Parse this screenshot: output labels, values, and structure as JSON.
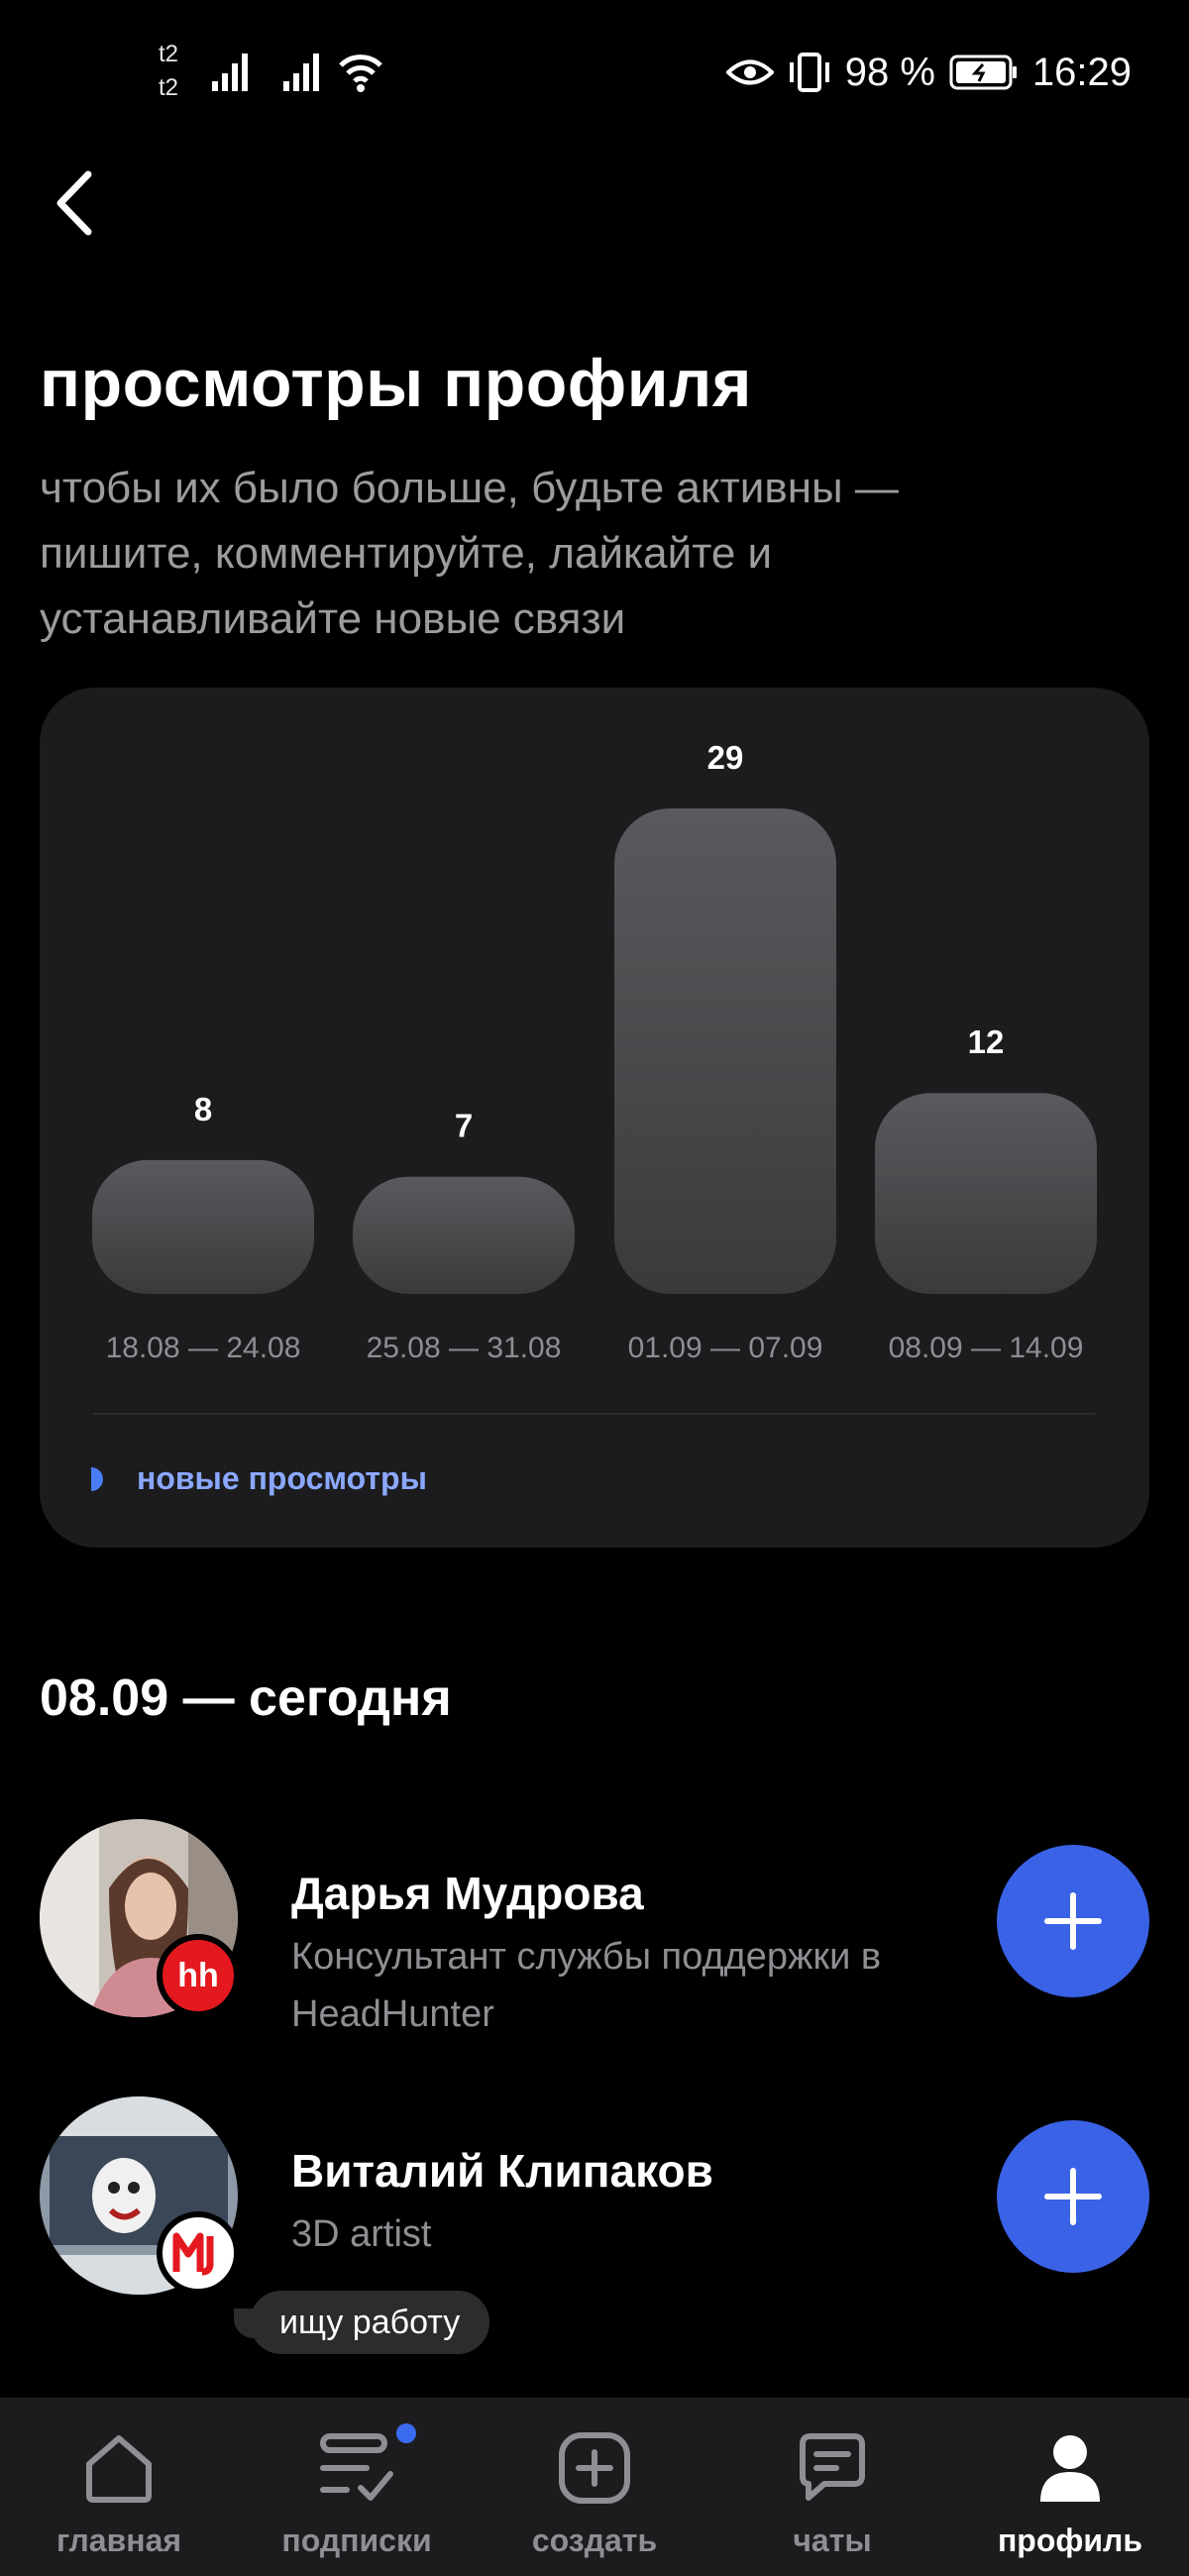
{
  "status_bar": {
    "carrier_1": "t2",
    "carrier_2": "t2",
    "battery": "98 %",
    "time": "16:29"
  },
  "header": {
    "back_icon": "chevron-left-icon",
    "title": "просмотры профиля",
    "subtitle": "чтобы их было больше, будьте активны — пишите, комментируйте, лайкайте и устанавливайте новые связи"
  },
  "chart_data": {
    "type": "bar",
    "categories": [
      "18.08 — 24.08",
      "25.08 — 31.08",
      "01.09 — 07.09",
      "08.09 — 14.09"
    ],
    "values": [
      8,
      7,
      29,
      12
    ],
    "series": [
      {
        "name": "новые просмотры",
        "values": [
          8,
          7,
          29,
          12
        ]
      }
    ],
    "legend": "bottom-left",
    "grid": false,
    "colors": {
      "bar_top": "#5a5a5e",
      "bar_bottom": "#3a3a3c",
      "legend": "#4a7df5"
    }
  },
  "section": {
    "title": "08.09 — сегодня"
  },
  "people": [
    {
      "name": "Дарья Мудрова",
      "role": "Консультант службы поддержки в HeadHunter",
      "badge": "hh"
    },
    {
      "name": "Виталий Клипаков",
      "role": "3D artist",
      "tag": "ищу работу"
    }
  ],
  "nav": {
    "items": [
      {
        "label": "главная",
        "icon": "home-icon"
      },
      {
        "label": "подписки",
        "icon": "subscriptions-icon"
      },
      {
        "label": "создать",
        "icon": "plus-square-icon"
      },
      {
        "label": "чаты",
        "icon": "chat-icon"
      },
      {
        "label": "профиль",
        "icon": "profile-icon"
      }
    ],
    "active": "профиль"
  },
  "colors": {
    "accent": "#3a62e6",
    "card": "#1c1c1e",
    "background": "#000000"
  }
}
